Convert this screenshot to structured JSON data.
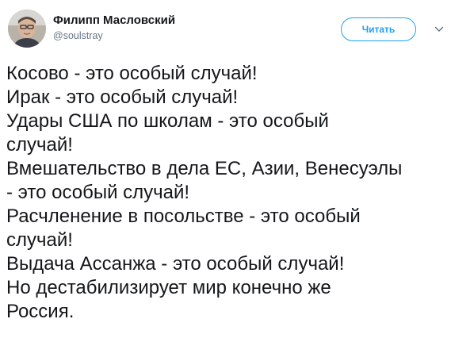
{
  "author": {
    "display_name": "Филипп Масловский",
    "handle": "@soulstray"
  },
  "follow_button": {
    "label": "Читать"
  },
  "tweet": {
    "lines": [
      "Косово - это особый случай!",
      "Ирак - это особый случай!",
      "Удары США по школам - это особый",
      "случай!",
      "Вмешательство в дела ЕС, Азии, Венесуэлы",
      "- это особый случай!",
      "Расчленение в посольстве - это особый",
      "случай!",
      "Выдача Ассанжа - это особый случай!",
      "Но дестабилизирует мир конечно же",
      "Россия."
    ]
  },
  "icons": {
    "menu": "chevron-down-icon",
    "avatar": "avatar"
  },
  "colors": {
    "accent": "#1da1f2",
    "text": "#14171a",
    "secondary_text": "#657786",
    "background": "#ffffff"
  }
}
